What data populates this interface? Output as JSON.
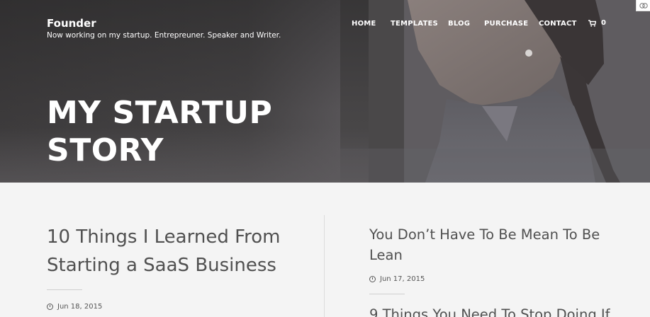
{
  "site": {
    "title": "Founder",
    "tagline": "Now working on my startup. Entrepreuner. Speaker and Writer."
  },
  "nav": {
    "items": [
      "HOME",
      "TEMPLATES",
      "BLOG",
      "PURCHASE",
      "CONTACT"
    ],
    "cart_count": "0"
  },
  "hero": {
    "title": "MY STARTUP STORY"
  },
  "posts": [
    {
      "title": "10 Things I Learned From Starting a SaaS Business",
      "date": "Jun 18, 2015"
    },
    {
      "title": "You Don’t Have To Be Mean To Be Lean",
      "date": "Jun 17, 2015"
    },
    {
      "title": "9 Things You Need To Stop Doing If"
    }
  ],
  "colors": {
    "hero_overlay": "#454344",
    "text_dark": "#505050",
    "page_bg": "#f4f4f4"
  }
}
